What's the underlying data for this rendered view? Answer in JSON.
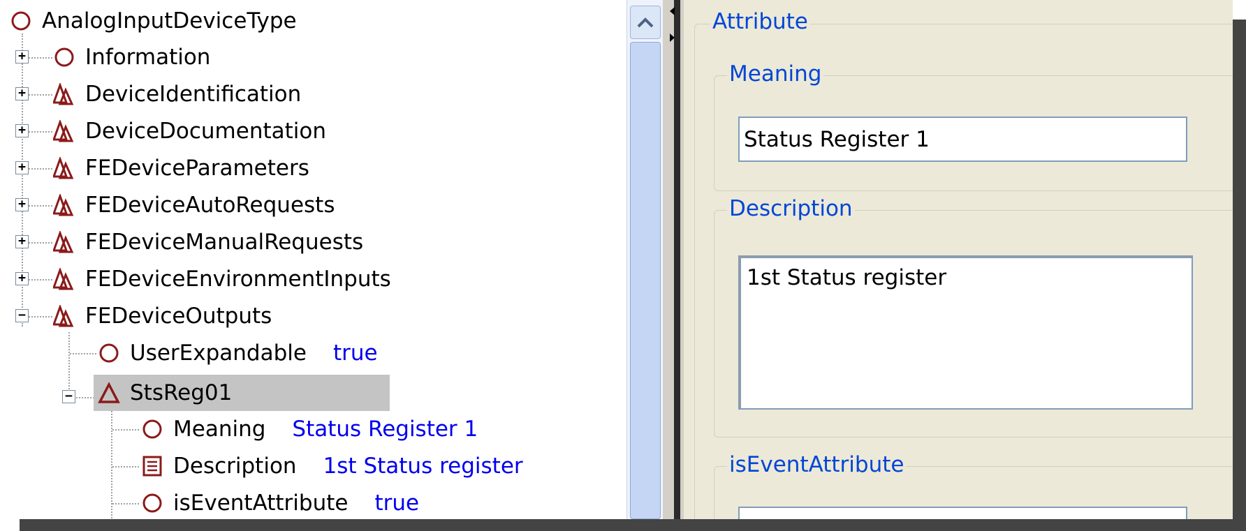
{
  "tree": {
    "root": {
      "label": "AnalogInputDeviceType",
      "icon": "circle-icon"
    },
    "items": [
      {
        "label": "Information",
        "icon": "circle-icon",
        "expander": "+"
      },
      {
        "label": "DeviceIdentification",
        "icon": "triangle-group-icon",
        "expander": "+"
      },
      {
        "label": "DeviceDocumentation",
        "icon": "triangle-group-icon",
        "expander": "+"
      },
      {
        "label": "FEDeviceParameters",
        "icon": "triangle-group-icon",
        "expander": "+"
      },
      {
        "label": "FEDeviceAutoRequests",
        "icon": "triangle-group-icon",
        "expander": "+"
      },
      {
        "label": "FEDeviceManualRequests",
        "icon": "triangle-group-icon",
        "expander": "+"
      },
      {
        "label": "FEDeviceEnvironmentInputs",
        "icon": "triangle-group-icon",
        "expander": "+"
      },
      {
        "label": "FEDeviceOutputs",
        "icon": "triangle-group-icon",
        "expander": "−"
      }
    ],
    "outputs_children": [
      {
        "label": "UserExpandable",
        "value": "true",
        "icon": "circle-icon"
      },
      {
        "label": "StsReg01",
        "icon": "triangle-icon",
        "expander": "−",
        "selected": true
      }
    ],
    "stsreg_children": [
      {
        "label": "Meaning",
        "value": "Status Register 1",
        "icon": "circle-icon"
      },
      {
        "label": "Description",
        "value": "1st Status register",
        "icon": "text-document-icon"
      },
      {
        "label": "isEventAttribute",
        "value": "true",
        "icon": "circle-icon"
      }
    ]
  },
  "properties": {
    "section_title": "Attribute",
    "meaning": {
      "legend": "Meaning",
      "value": "Status Register 1"
    },
    "description": {
      "legend": "Description",
      "value": "1st Status register"
    },
    "is_event": {
      "legend": "isEventAttribute"
    }
  },
  "colors": {
    "value_text": "#0000ee",
    "legend_text": "#0046d5",
    "icon": "#8b1a1a",
    "panel_bg": "#ece9d8",
    "selection": "#c4c4c4"
  }
}
